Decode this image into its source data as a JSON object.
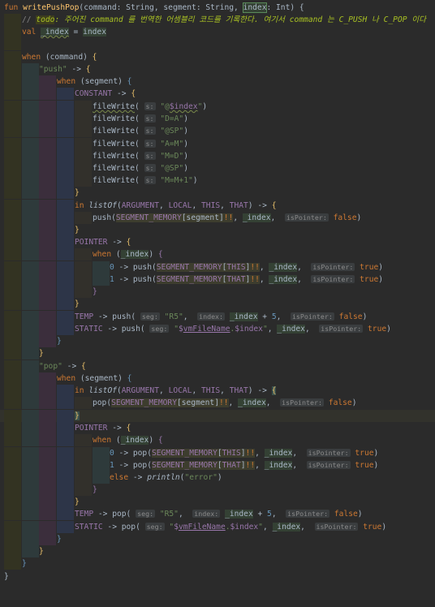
{
  "editor": {
    "lines": [
      "fun writePushPop(command: String, segment: String, index: Int) {",
      "    // todo: 주어진 command 를 번역한 어셈블리 코드를 기록한다. 여기서 command 는 C_PUSH 나 C_POP 이다",
      "    val _index = index",
      "",
      "    when (command) {",
      "        \"push\" -> {",
      "            when (segment) {",
      "                CONSTANT -> {",
      "                    fileWrite( s: \"@$index\")",
      "                    fileWrite( s: \"D=A\")",
      "                    fileWrite( s: \"@SP\")",
      "                    fileWrite( s: \"A=M\")",
      "                    fileWrite( s: \"M=D\")",
      "                    fileWrite( s: \"@SP\")",
      "                    fileWrite( s: \"M=M+1\")",
      "                }",
      "                in listOf(ARGUMENT, LOCAL, THIS, THAT) -> {",
      "                    push(SEGMENT_MEMORY[segment]!!, _index,  isPointer: false)",
      "                }",
      "                POINTER -> {",
      "                    when (_index) {",
      "                        0 -> push(SEGMENT_MEMORY[THIS]!!, _index,  isPointer: true)",
      "                        1 -> push(SEGMENT_MEMORY[THAT]!!, _index,  isPointer: true)",
      "                    }",
      "                }",
      "                TEMP -> push( seg: \"R5\",  index: _index + 5,  isPointer: false)",
      "                STATIC -> push( seg: \"$vmFileName.$index\", _index,  isPointer: true)",
      "            }",
      "        }",
      "        \"pop\" -> {",
      "            when (segment) {",
      "                in listOf(ARGUMENT, LOCAL, THIS, THAT) -> {",
      "                    pop(SEGMENT_MEMORY[segment]!!, _index,  isPointer: false)",
      "                }",
      "                POINTER -> {",
      "                    when (_index) {",
      "                        0 -> pop(SEGMENT_MEMORY[THIS]!!, _index,  isPointer: true)",
      "                        1 -> pop(SEGMENT_MEMORY[THAT]!!, _index,  isPointer: true)",
      "                        else -> println(\"error\")",
      "                    }",
      "                }",
      "                TEMP -> pop( seg: \"R5\",  index: _index + 5,  isPointer: false)",
      "                STATIC -> pop( seg: \"$vmFileName.$index\", _index,  isPointer: true)",
      "            }",
      "        }",
      "    }",
      "}"
    ]
  }
}
